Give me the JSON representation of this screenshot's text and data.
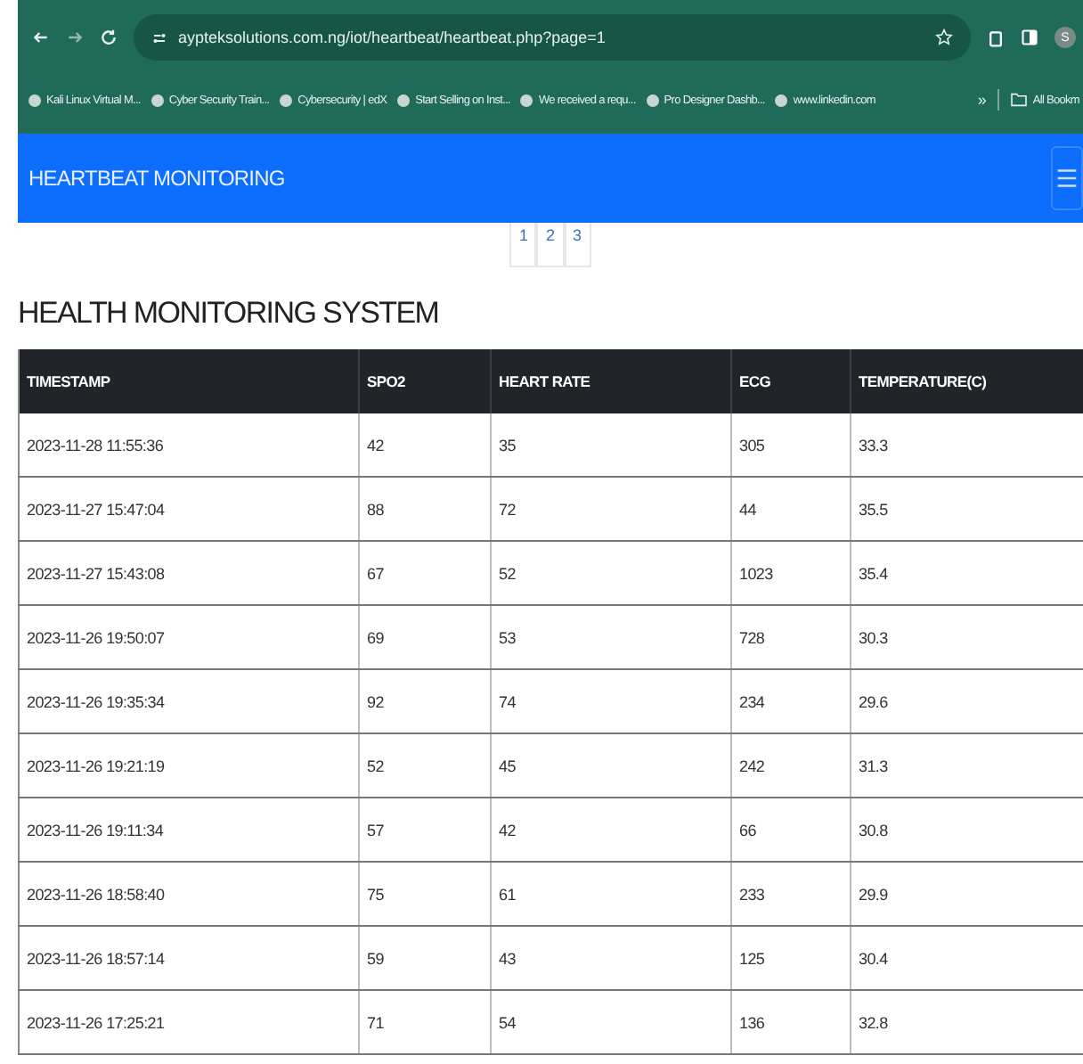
{
  "browser": {
    "url": "aypteksolutions.com.ng/iot/heartbeat/heartbeat.php?page=1",
    "profile_initial": "S",
    "bookmarks": [
      "Kali Linux Virtual M...",
      "Cyber Security Train...",
      "Cybersecurity | edX",
      "Start Selling on Inst...",
      "We received a requ...",
      "Pro Designer Dashb...",
      "www.linkedin.com"
    ],
    "more": "»",
    "all_bookmarks": "All Bookm"
  },
  "navbar": {
    "brand": "HEARTBEAT MONITORING"
  },
  "pagination": [
    {
      "label": "1",
      "selected": false
    },
    {
      "label": "2",
      "selected": false
    },
    {
      "label": "3",
      "selected": false
    }
  ],
  "heading": "HEALTH MONITORING SYSTEM",
  "table": {
    "columns": [
      "TIMESTAMP",
      "SPO2",
      "HEART RATE",
      "ECG",
      "TEMPERATURE(C)"
    ],
    "rows": [
      [
        "2023-11-28 11:55:36",
        "42",
        "35",
        "305",
        "33.3"
      ],
      [
        "2023-11-27 15:47:04",
        "88",
        "72",
        "44",
        "35.5"
      ],
      [
        "2023-11-27 15:43:08",
        "67",
        "52",
        "1023",
        "35.4"
      ],
      [
        "2023-11-26 19:50:07",
        "69",
        "53",
        "728",
        "30.3"
      ],
      [
        "2023-11-26 19:35:34",
        "92",
        "74",
        "234",
        "29.6"
      ],
      [
        "2023-11-26 19:21:19",
        "52",
        "45",
        "242",
        "31.3"
      ],
      [
        "2023-11-26 19:11:34",
        "57",
        "42",
        "66",
        "30.8"
      ],
      [
        "2023-11-26 18:58:40",
        "75",
        "61",
        "233",
        "29.9"
      ],
      [
        "2023-11-26 18:57:14",
        "59",
        "43",
        "125",
        "30.4"
      ],
      [
        "2023-11-26 17:25:21",
        "71",
        "54",
        "136",
        "32.8"
      ]
    ]
  }
}
